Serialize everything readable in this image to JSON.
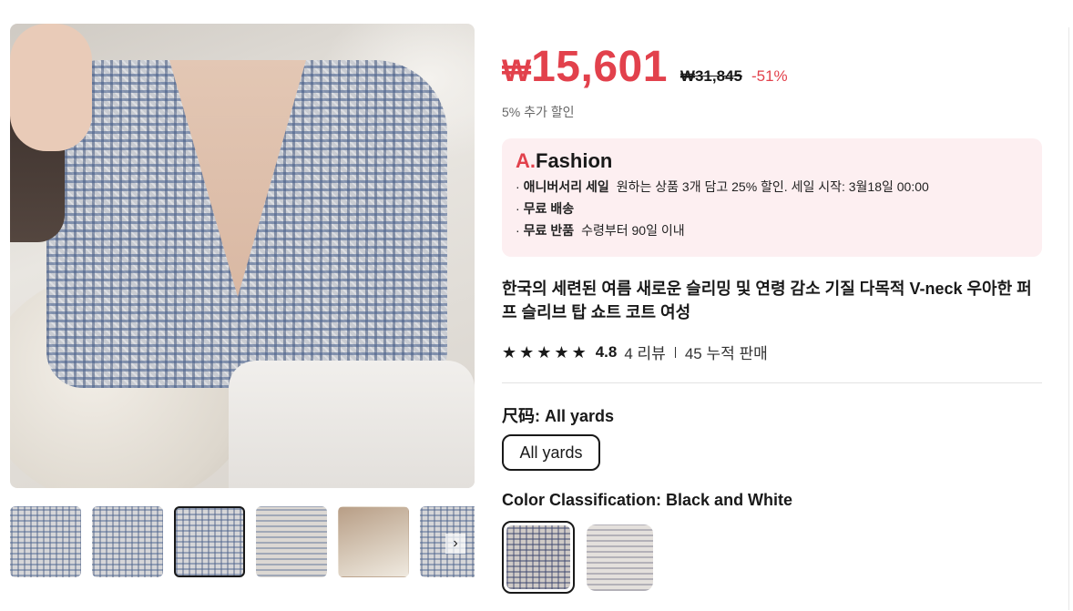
{
  "gallery": {
    "thumb_next_icon": "chevron-right-icon"
  },
  "price": {
    "currency": "₩",
    "value": "15,601",
    "original": "₩31,845",
    "discount": "-51%",
    "extra_discount": "5% 추가 할인",
    "accent_color": "#e2414c"
  },
  "promo": {
    "brand_a": "A.",
    "brand_rest": "Fashion",
    "lines": [
      {
        "bullet": "·",
        "title": "애니버서리 세일",
        "desc": "원하는 상품 3개 담고 25% 할인. 세일 시작: 3월18일 00:00"
      },
      {
        "bullet": "·",
        "title": "무료 배송",
        "desc": ""
      },
      {
        "bullet": "·",
        "title": "무료 반품",
        "desc": "수령부터 90일 이내"
      }
    ]
  },
  "product": {
    "title": "한국의 세련된 여름 새로운 슬리밍 및 연령 감소 기질 다목적 V-neck 우아한 퍼프 슬리브 탑 쇼트 코트 여성"
  },
  "rating": {
    "stars": 5,
    "value": "4.8",
    "reviews": "4 리뷰",
    "sold": "45 누적 판매"
  },
  "size": {
    "label": "尺码: All yards",
    "option": "All yards"
  },
  "color": {
    "label": "Color Classification: Black and White"
  }
}
